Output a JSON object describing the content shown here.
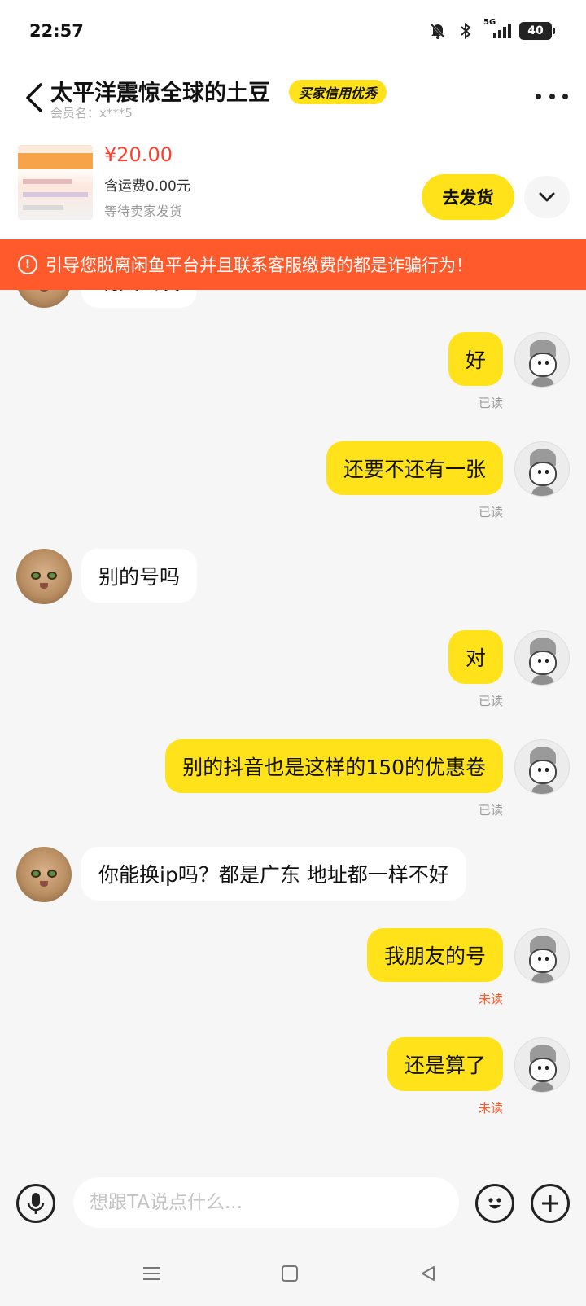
{
  "status_bar": {
    "time": "22:57",
    "network": "5G",
    "battery": "40"
  },
  "header": {
    "title": "太平洋震惊全球的土豆",
    "credit_badge": "买家信用优秀",
    "member_label": "会员名：x***5"
  },
  "product": {
    "price": "¥20.00",
    "shipping": "含运费0.00元",
    "status": "等待卖家发货",
    "ship_button": "去发货"
  },
  "warning": {
    "text": "引导您脱离闲鱼平台并且联系客服缴费的都是诈骗行为！"
  },
  "messages": [
    {
      "side": "left",
      "text": "明天去发"
    },
    {
      "side": "right",
      "text": "好",
      "receipt": "已读"
    },
    {
      "side": "right",
      "text": "还要不还有一张",
      "receipt": "已读"
    },
    {
      "side": "left",
      "text": "别的号吗"
    },
    {
      "side": "right",
      "text": "对",
      "receipt": "已读"
    },
    {
      "side": "right",
      "text": "别的抖音也是这样的150的优惠卷",
      "receipt": "已读"
    },
    {
      "side": "left",
      "text": "你能换ip吗？都是广东 地址都一样不好"
    },
    {
      "side": "right",
      "text": "我朋友的号",
      "receipt": "未读"
    },
    {
      "side": "right",
      "text": "还是算了",
      "receipt": "未读"
    }
  ],
  "input": {
    "placeholder": "想跟TA说点什么..."
  },
  "icons": {
    "back": "chevron-left-icon",
    "more": "more-dots-icon",
    "expand": "chevron-down-icon",
    "warning": "alert-circle-icon",
    "voice": "microphone-icon",
    "emoji": "emoji-icon",
    "add": "plus-icon"
  },
  "colors": {
    "accent": "#ffe21a",
    "warning": "#ff5a2b",
    "price": "#ff3d2e",
    "background": "#f6f6f6"
  }
}
